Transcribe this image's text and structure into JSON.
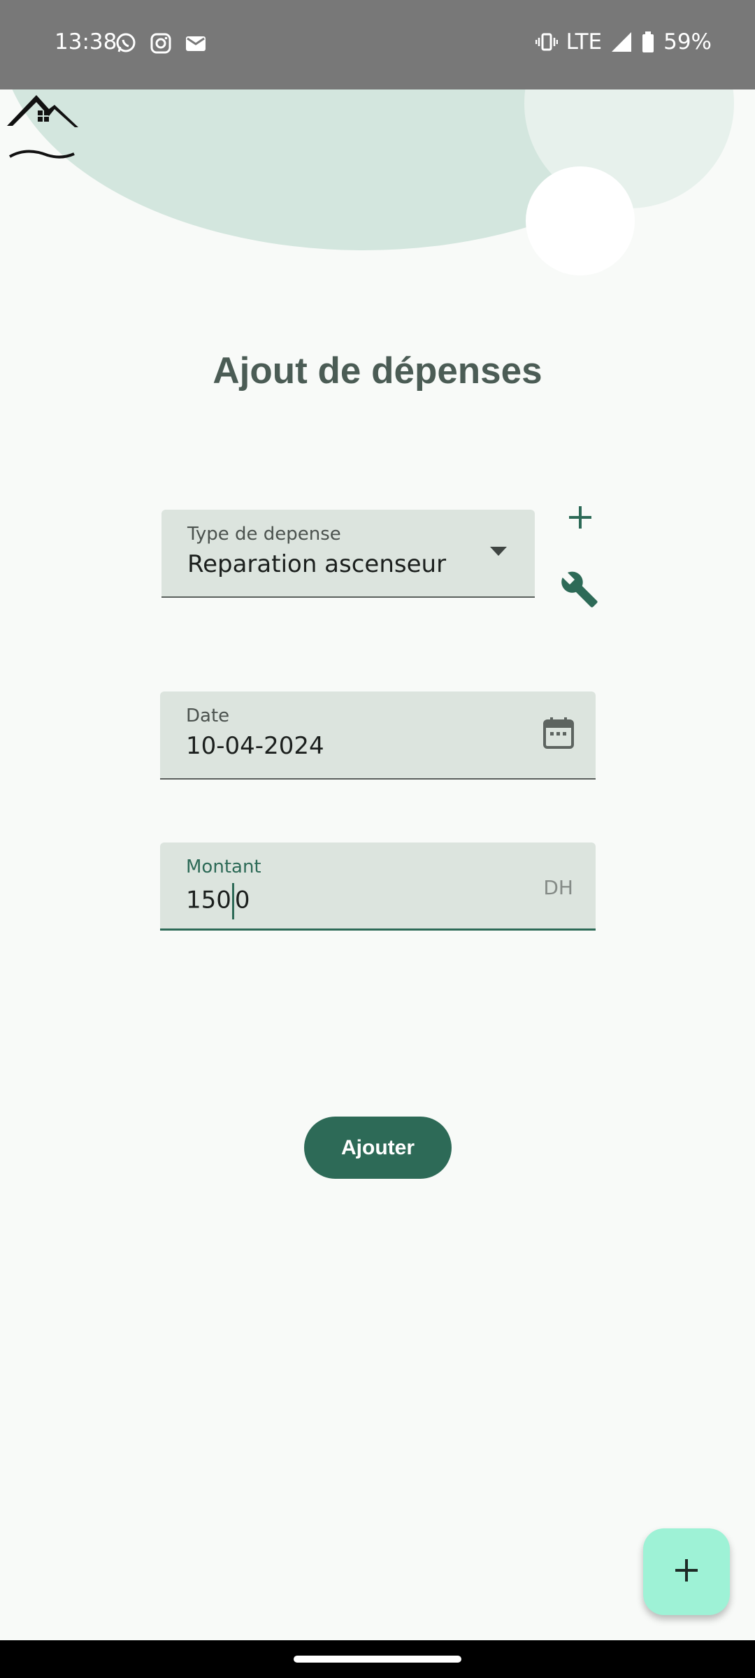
{
  "status_bar": {
    "time": "13:38",
    "network": "LTE",
    "battery": "59%",
    "icons": [
      "whatsapp-icon",
      "instagram-icon",
      "mail-icon",
      "vibrate-icon",
      "signal-icon",
      "battery-icon"
    ]
  },
  "page": {
    "title": "Ajout de dépenses"
  },
  "form": {
    "type": {
      "label": "Type de depense",
      "value": "Reparation ascenseur"
    },
    "date": {
      "label": "Date",
      "value": "10-04-2024"
    },
    "amount": {
      "label": "Montant",
      "value_before_cursor": "150",
      "value_after_cursor": "0",
      "suffix": "DH"
    }
  },
  "actions": {
    "submit_label": "Ajouter"
  },
  "colors": {
    "accent": "#2d6a57",
    "fab": "#9ef2d6",
    "header_blob": "#d3e6de",
    "field_bg": "#dce4de"
  }
}
